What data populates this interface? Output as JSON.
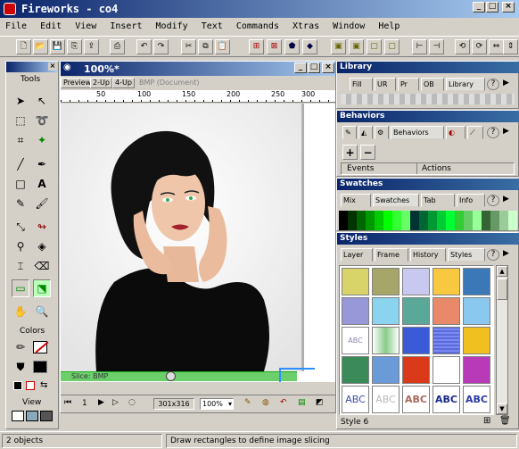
{
  "app": {
    "title": "Fireworks - co4"
  },
  "menu": [
    "File",
    "Edit",
    "View",
    "Insert",
    "Modify",
    "Text",
    "Commands",
    "Xtras",
    "Window",
    "Help"
  ],
  "tools": {
    "title": "Tools",
    "colors_label": "Colors",
    "view_label": "View"
  },
  "document": {
    "title": "100%*",
    "tabs": [
      "Preview",
      "2-Up",
      "4-Up",
      "BMP (Document)"
    ],
    "ruler": [
      "50",
      "100",
      "150",
      "200",
      "250",
      "300"
    ],
    "slice_label": "Slice: BMP",
    "page_number": "1",
    "dimensions": "301x316",
    "zoom": "100%"
  },
  "library": {
    "title": "Library",
    "tabs": [
      "Fill",
      "UR",
      "Pr",
      "OB",
      "Library"
    ]
  },
  "behaviors": {
    "title": "Behaviors",
    "tabs": [
      "Behaviors"
    ],
    "col_events": "Events",
    "col_actions": "Actions",
    "add": "+",
    "remove": "−"
  },
  "swatches": {
    "title": "Swatches",
    "tabs": [
      "Mix",
      "Swatches",
      "Tab",
      "Info"
    ]
  },
  "styles": {
    "title": "Styles",
    "tabs": [
      "Layer",
      "Frame",
      "History",
      "Styles"
    ],
    "text_abc": "ABC",
    "status": "Style 6"
  },
  "statusbar": {
    "objects": "2 objects",
    "hint": "Draw rectangles to define image slicing"
  },
  "colors": {
    "titlebar": "#0a246a",
    "slice": "#6ccf6c",
    "face": "#d4d0c8"
  }
}
